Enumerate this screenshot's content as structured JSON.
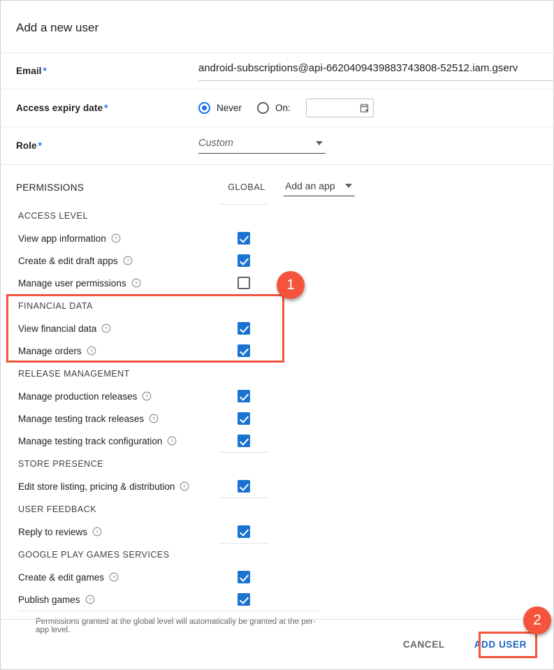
{
  "dialog": {
    "title": "Add a new user"
  },
  "fields": {
    "email": {
      "label": "Email",
      "required_marker": "*",
      "value": "android-subscriptions@api-6620409439883743808-52512.iam.gserv"
    },
    "expiry": {
      "label": "Access expiry date",
      "required_marker": "*",
      "option_never": "Never",
      "option_on": "On:",
      "date_value": "",
      "calendar_icon": "calendar-icon"
    },
    "role": {
      "label": "Role",
      "required_marker": "*",
      "value": "Custom",
      "caret_icon": "chevron-down-icon"
    }
  },
  "permissions": {
    "section_title": "PERMISSIONS",
    "global_column": "GLOBAL",
    "add_app_label": "Add an app",
    "add_app_caret": "chevron-down-icon",
    "footnote": "Permissions granted at the global level will automatically be granted at the per-app level.",
    "help_icon": "help-circle-icon",
    "groups": [
      {
        "name": "ACCESS LEVEL",
        "rows": [
          {
            "label": "View app information",
            "checked": true
          },
          {
            "label": "Create & edit draft apps",
            "checked": true
          },
          {
            "label": "Manage user permissions",
            "checked": false
          }
        ]
      },
      {
        "name": "FINANCIAL DATA",
        "rows": [
          {
            "label": "View financial data",
            "checked": true
          },
          {
            "label": "Manage orders",
            "checked": true
          }
        ]
      },
      {
        "name": "RELEASE MANAGEMENT",
        "rows": [
          {
            "label": "Manage production releases",
            "checked": true
          },
          {
            "label": "Manage testing track releases",
            "checked": true
          },
          {
            "label": "Manage testing track configuration",
            "checked": true
          }
        ]
      },
      {
        "name": "STORE PRESENCE",
        "rows": [
          {
            "label": "Edit store listing, pricing & distribution",
            "checked": true
          }
        ]
      },
      {
        "name": "USER FEEDBACK",
        "rows": [
          {
            "label": "Reply to reviews",
            "checked": true
          }
        ]
      },
      {
        "name": "GOOGLE PLAY GAMES SERVICES",
        "rows": [
          {
            "label": "Create & edit games",
            "checked": true
          },
          {
            "label": "Publish games",
            "checked": true
          }
        ]
      }
    ]
  },
  "footer": {
    "cancel_label": "CANCEL",
    "add_user_label": "ADD USER"
  },
  "annotations": {
    "accent_color": "#f4533c",
    "badges": [
      {
        "number": "1"
      },
      {
        "number": "2"
      }
    ]
  }
}
